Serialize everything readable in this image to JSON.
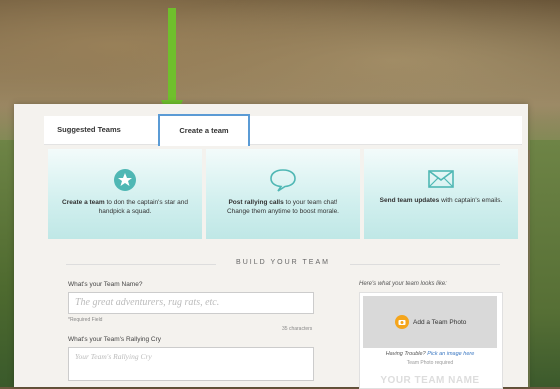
{
  "tabs": [
    {
      "label": "Suggested Teams"
    },
    {
      "label": "Create a team"
    }
  ],
  "features": [
    {
      "icon": "star-badge-icon",
      "bold": "Create a team",
      "text": " to don the captain's star and handpick a squad."
    },
    {
      "icon": "speech-bubble-icon",
      "bold": "Post rallying calls",
      "text": " to your team chat! Change them anytime to boost morale."
    },
    {
      "icon": "envelope-icon",
      "bold": "Send team updates",
      "text": " with captain's emails."
    }
  ],
  "build": {
    "title": "BUILD YOUR TEAM",
    "name_label": "What's your Team Name?",
    "name_placeholder": "The great adventurers, rug rats, etc.",
    "required_note": "*Required Field",
    "char_count": "35 characters",
    "cry_label": "What's your Team's Rallying Cry",
    "cry_placeholder": "Your Team's Rallying Cry"
  },
  "preview": {
    "label": "Here's what your team looks like:",
    "add_photo": "Add a Team Photo",
    "trouble_text": "Having Trouble?",
    "trouble_link": "Pick an image here",
    "photo_required": "Team Photo required",
    "team_name": "YOUR TEAM NAME"
  },
  "colors": {
    "accent": "#6fbf2c",
    "tab_border": "#5b9bd5",
    "teal": "#4fb7b4",
    "photo_icon": "#f4a51c"
  }
}
